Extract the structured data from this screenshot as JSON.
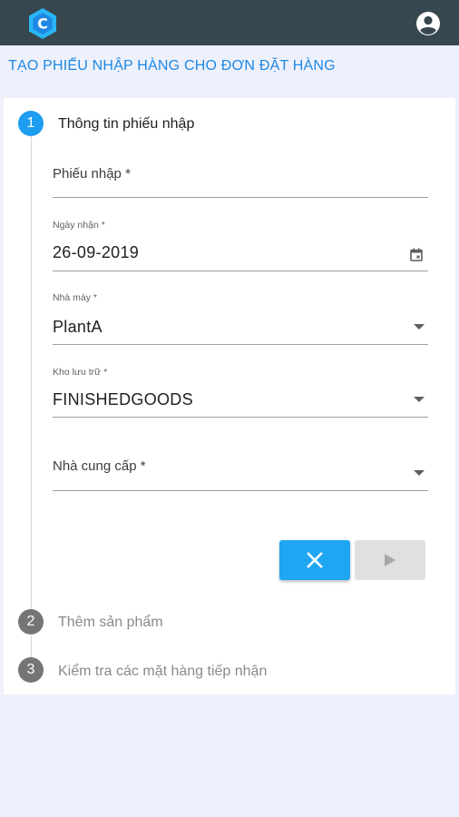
{
  "app": {
    "logo_letter": "C"
  },
  "page": {
    "title": "TẠO PHIẾU NHẬP HÀNG CHO ĐƠN ĐẶT HÀNG"
  },
  "steps": [
    {
      "number": "1",
      "label": "Thông tin phiếu nhập",
      "state": "active"
    },
    {
      "number": "2",
      "label": "Thêm sản phẩm",
      "state": "inactive"
    },
    {
      "number": "3",
      "label": "Kiểm tra các mặt hàng tiếp nhận",
      "state": "inactive"
    }
  ],
  "form": {
    "receipt": {
      "label": "Phiếu nhập *",
      "value": ""
    },
    "received_date": {
      "label": "Ngày nhận *",
      "value": "26-09-2019"
    },
    "plant": {
      "label": "Nhà máy *",
      "value": "PlantA"
    },
    "warehouse": {
      "label": "Kho lưu trữ *",
      "value": "FINISHEDGOODS"
    },
    "supplier": {
      "label": "Nhà cung cấp *",
      "value": ""
    }
  },
  "colors": {
    "appbar": "#37474f",
    "accent": "#1e9cf0",
    "title": "#1e88e5",
    "inactive_step": "#757575",
    "background": "#eef1fb"
  },
  "icons": {
    "logo": "cube-c-logo-icon",
    "account": "account-circle-icon",
    "calendar": "calendar-icon",
    "dropdown": "dropdown-arrow-icon",
    "cancel": "close-icon",
    "next": "play-arrow-icon"
  }
}
